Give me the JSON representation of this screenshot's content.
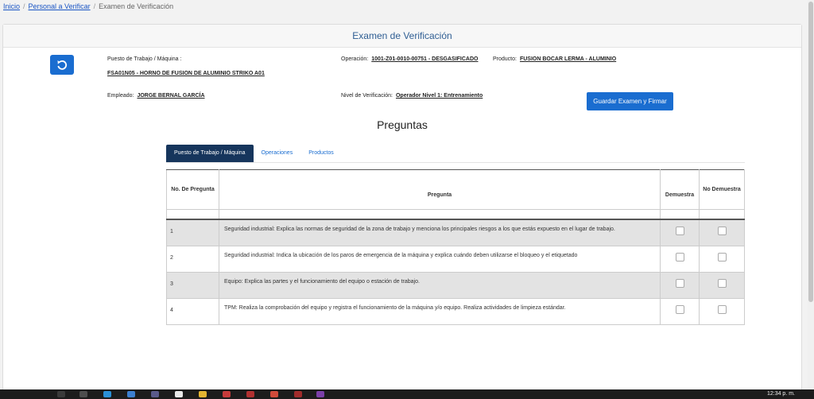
{
  "breadcrumb": {
    "home": "Inicio",
    "personal": "Personal a Verificar",
    "current": "Examen de Verificación"
  },
  "header": {
    "title": "Examen de Verificación"
  },
  "info": {
    "puesto_label": "Puesto de Trabajo / Máquina :",
    "puesto_value": "FSA01N05 - HORNO DE FUSION DE ALUMINIO STRIKO A01",
    "operacion_label": "Operación:",
    "operacion_value": "1001-Z01-0010-00751 - DESGASIFICADO",
    "producto_label": "Producto:",
    "producto_value": "FUSION BOCAR LERMA - ALUMINIO",
    "empleado_label": "Empleado:",
    "empleado_value": "JORGE BERNAL GARCÍA",
    "nivel_label": "Nivel de Verificación:",
    "nivel_value": "Operador Nivel 1: Entrenamiento"
  },
  "save_button": "Guardar Examen y Firmar",
  "section_title": "Preguntas",
  "tabs": [
    "Puesto de Trabajo / Máquina",
    "Operaciones",
    "Productos"
  ],
  "table": {
    "headers": [
      "No. De Pregunta",
      "Pregunta",
      "Demuestra",
      "No Demuestra"
    ],
    "rows": [
      {
        "num": "1",
        "text": "Seguridad industrial: Explica las normas de seguridad de la zona de trabajo y menciona los principales riesgos a los que estás expuesto en el lugar de trabajo."
      },
      {
        "num": "2",
        "text": "Seguridad industrial: Indica la ubicación de los paros de emergencia de la máquina y explica cuándo deben utilizarse el bloqueo y el etiquetado"
      },
      {
        "num": "3",
        "text": "Equipo: Explica las partes y el funcionamiento del equipo o estación de trabajo."
      },
      {
        "num": "4",
        "text": "TPM: Realiza la comprobación del equipo y registra el funcionamiento de la máquina y/o equipo. Realiza actividades de limpieza estándar."
      }
    ]
  },
  "taskbar": {
    "clock": "12:34 p. m."
  },
  "colors": {
    "accent": "#1a6dd0",
    "active_tab": "#16355c"
  }
}
